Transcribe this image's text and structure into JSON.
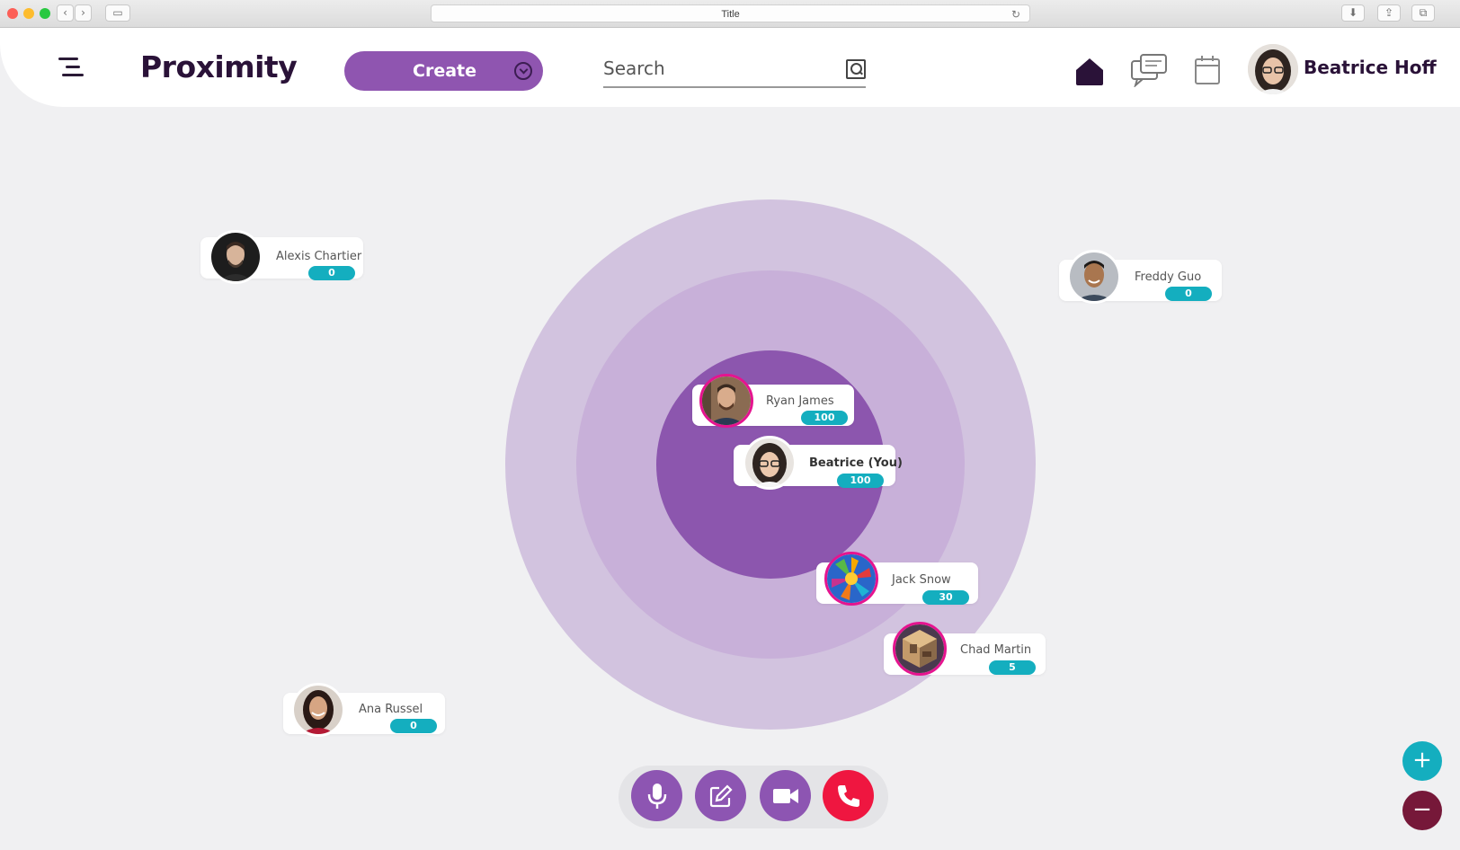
{
  "browser": {
    "title": "Title",
    "reload_icon": "↻"
  },
  "header": {
    "menu_icon": "menu-icon",
    "logo": "Proximity",
    "create_label": "Create",
    "search_placeholder": "Search",
    "user_name": "Beatrice Hoff"
  },
  "people": [
    {
      "name": "Alexis Chartier",
      "score": "0",
      "ring": "outside"
    },
    {
      "name": "Freddy Guo",
      "score": "0",
      "ring": "outside"
    },
    {
      "name": "Ryan James",
      "score": "100",
      "ring": "inner"
    },
    {
      "name": "Beatrice (You)",
      "score": "100",
      "ring": "inner"
    },
    {
      "name": "Jack Snow",
      "score": "30",
      "ring": "middle"
    },
    {
      "name": "Chad Martin",
      "score": "5",
      "ring": "outer"
    },
    {
      "name": "Ana Russel",
      "score": "0",
      "ring": "outside"
    }
  ],
  "controls": {
    "mic": "microphone-icon",
    "edit": "edit-icon",
    "video": "video-camera-icon",
    "end_call": "phone-icon"
  },
  "zoom": {
    "in_label": "+",
    "out_label": "−"
  },
  "colors": {
    "brand_purple": "#8c56ae",
    "teal": "#14aebf",
    "pink_ring": "#e5148f",
    "end_call_red": "#ef1640",
    "zoom_out": "#761839"
  }
}
